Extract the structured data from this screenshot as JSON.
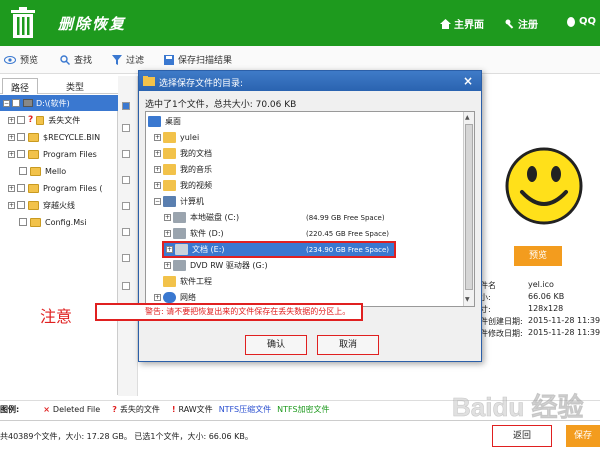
{
  "header": {
    "title": "删除恢复",
    "nav_home": "主界面",
    "nav_register": "注册",
    "nav_qq": "QQ",
    "bg_color": "#1e9a1e"
  },
  "toolbar": {
    "preview": "预览",
    "search": "查找",
    "filter": "过滤",
    "save_scan": "保存扫描结果"
  },
  "left_tabs": {
    "path": "路径",
    "type": "类型"
  },
  "tree": [
    {
      "label": "D:\\(软件)"
    },
    {
      "label": "丢失文件"
    },
    {
      "label": "$RECYCLE.BIN"
    },
    {
      "label": "Program Files"
    },
    {
      "label": "Mello"
    },
    {
      "label": "Program Files ("
    },
    {
      "label": "穿越火线"
    },
    {
      "label": "Config.Msi"
    }
  ],
  "dialog": {
    "title": "选择保存文件的目录:",
    "close": "×",
    "selection_info": "选中了1个文件，总共大小: 70.06 KB",
    "items": [
      {
        "label": "桌面",
        "space": ""
      },
      {
        "label": "yulei",
        "space": ""
      },
      {
        "label": "我的文档",
        "space": ""
      },
      {
        "label": "我的音乐",
        "space": ""
      },
      {
        "label": "我的视频",
        "space": ""
      },
      {
        "label": "计算机",
        "space": ""
      },
      {
        "label": "本地磁盘 (C:)",
        "space": "(84.99 GB Free Space)"
      },
      {
        "label": "软件 (D:)",
        "space": "(220.45 GB Free Space)"
      },
      {
        "label": "文档 (E:)",
        "space": "(234.90 GB Free Space)"
      },
      {
        "label": "DVD RW 驱动器 (G:)",
        "space": ""
      },
      {
        "label": "软件工程",
        "space": ""
      },
      {
        "label": "网络",
        "space": ""
      }
    ],
    "warning": "警告: 请不要把恢复出来的文件保存在丢失数据的分区上。",
    "ok": "确认",
    "cancel": "取消"
  },
  "annotation": "注意",
  "right_panel": {
    "preview_btn": "预览",
    "info": [
      {
        "key": "件名",
        "value": "yel.ico"
      },
      {
        "key": "小:",
        "value": "66.06 KB"
      },
      {
        "key": "寸:",
        "value": "128x128"
      },
      {
        "key": "件创建日期:",
        "value": "2015-11-28 11:39:47"
      },
      {
        "key": "件修改日期:",
        "value": "2015-11-28 11:39:5"
      }
    ]
  },
  "legend": {
    "label": "图例:",
    "deleted": "Deleted File",
    "lost": "丢失的文件",
    "raw": "RAW文件",
    "ntfs_compressed": "NTFS压缩文件",
    "ntfs_encrypted": "NTFS加密文件"
  },
  "status": {
    "text": "共40389个文件，大小: 17.28 GB。 已选1个文件，大小: 66.06 KB。",
    "back": "返回",
    "save": "保存"
  },
  "watermark": "Baidu 经验",
  "colors": {
    "accent_orange": "#f39c1e",
    "warning_red": "#e02020",
    "select_blue": "#3a78d0"
  }
}
